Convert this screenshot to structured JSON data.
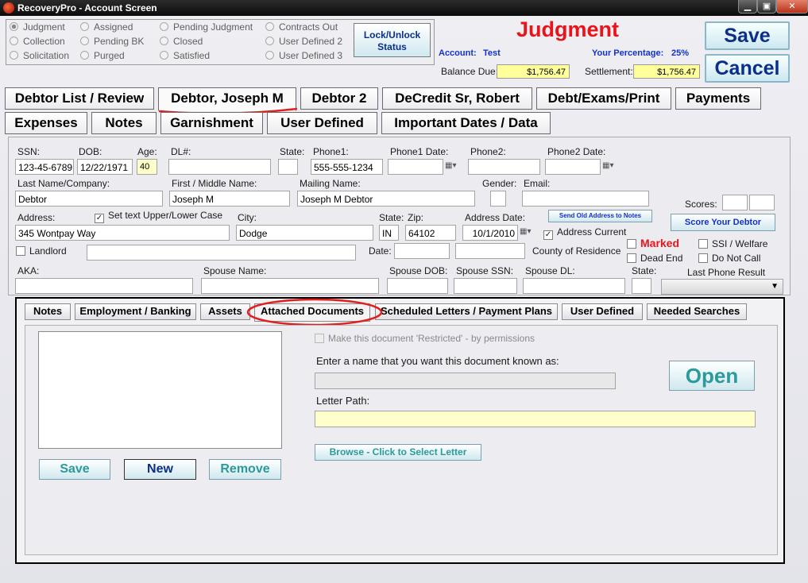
{
  "window": {
    "title": "RecoveryPro - Account Screen",
    "controls": [
      "▁",
      "▣",
      "✕"
    ]
  },
  "status_radios": [
    {
      "label": "Judgment",
      "selected": true
    },
    {
      "label": "Collection",
      "selected": false
    },
    {
      "label": "Solicitation",
      "selected": false
    },
    {
      "label": "Assigned",
      "selected": false
    },
    {
      "label": "Pending BK",
      "selected": false
    },
    {
      "label": "Purged",
      "selected": false
    },
    {
      "label": "Pending Judgment",
      "selected": false
    },
    {
      "label": "Closed",
      "selected": false
    },
    {
      "label": "Satisfied",
      "selected": false
    },
    {
      "label": "Contracts Out",
      "selected": false
    },
    {
      "label": "User Defined 2",
      "selected": false
    },
    {
      "label": "User Defined 3",
      "selected": false
    }
  ],
  "lock_button": "Lock/Unlock\nStatus",
  "header": {
    "status_title": "Judgment",
    "account_label": "Account:",
    "account_value": "Test",
    "percentage_label": "Your Percentage:",
    "percentage_value": "25%",
    "balance_label": "Balance Due:",
    "balance_value": "$1,756.47",
    "settlement_label": "Settlement:",
    "settlement_value": "$1,756.47",
    "save_label": "Save",
    "cancel_label": "Cancel"
  },
  "tabs_row1": [
    "Debtor List / Review",
    "Debtor, Joseph M",
    "Debtor 2",
    "DeCredit Sr, Robert",
    "Debt/Exams/Print",
    "Payments"
  ],
  "tabs_row2": [
    "Expenses",
    "Notes",
    "Garnishment",
    "User Defined",
    "Important Dates / Data"
  ],
  "form": {
    "ssn_label": "SSN:",
    "ssn": "123-45-6789",
    "dob_label": "DOB:",
    "dob": "12/22/1971",
    "age_label": "Age:",
    "age": "40",
    "dl_label": "DL#:",
    "dl": "",
    "state_label": "State:",
    "dl_state": "",
    "phone1_label": "Phone1:",
    "phone1": "555-555-1234",
    "phone1_date_label": "Phone1 Date:",
    "phone2_label": "Phone2:",
    "phone2": "",
    "phone2_date_label": "Phone2 Date:",
    "last_name_label": "Last Name/Company:",
    "last_name": "Debtor",
    "first_name_label": "First / Middle Name:",
    "first_name": "Joseph M",
    "mailing_name_label": "Mailing Name:",
    "mailing_name": "Joseph M Debtor",
    "gender_label": "Gender:",
    "gender": "",
    "email_label": "Email:",
    "email": "",
    "scores_label": "Scores:",
    "address_label": "Address:",
    "address": "345 Wontpay Way",
    "set_text_case_label": "Set text Upper/Lower Case",
    "city_label": "City:",
    "city": "Dodge",
    "addr_state_label": "State:",
    "addr_state": "IN",
    "zip_label": "Zip:",
    "zip": "64102",
    "address_date_label": "Address Date:",
    "address_date": "10/1/2010",
    "send_old_address_label": "Send Old Address to Notes",
    "score_debtor_label": "Score Your Debtor",
    "address_current_label": "Address Current",
    "landlord_label": "Landlord",
    "date_label": "Date:",
    "county_label": "County of Residence",
    "marked_label": "Marked",
    "ssi_label": "SSI / Welfare",
    "dead_end_label": "Dead End",
    "do_not_call_label": "Do Not Call",
    "aka_label": "AKA:",
    "spouse_name_label": "Spouse Name:",
    "spouse_dob_label": "Spouse DOB:",
    "spouse_ssn_label": "Spouse SSN:",
    "spouse_dl_label": "Spouse DL:",
    "spouse_state_label": "State:",
    "last_phone_result_label": "Last Phone Result"
  },
  "subtabs": [
    "Notes",
    "Employment / Banking",
    "Assets",
    "Attached Documents",
    "Scheduled Letters  /  Payment Plans",
    "User Defined",
    "Needed Searches"
  ],
  "documents": {
    "save_label": "Save",
    "new_label": "New",
    "remove_label": "Remove",
    "restricted_label": "Make this document 'Restricted' - by permissions",
    "name_prompt": "Enter a name that you want this document known as:",
    "open_label": "Open",
    "letter_path_label": "Letter Path:",
    "browse_label": "Browse - Click to Select Letter"
  },
  "colors": {
    "accent_red": "#e8141a",
    "annotation_red": "#e02020",
    "label_blue": "#1232c8"
  }
}
